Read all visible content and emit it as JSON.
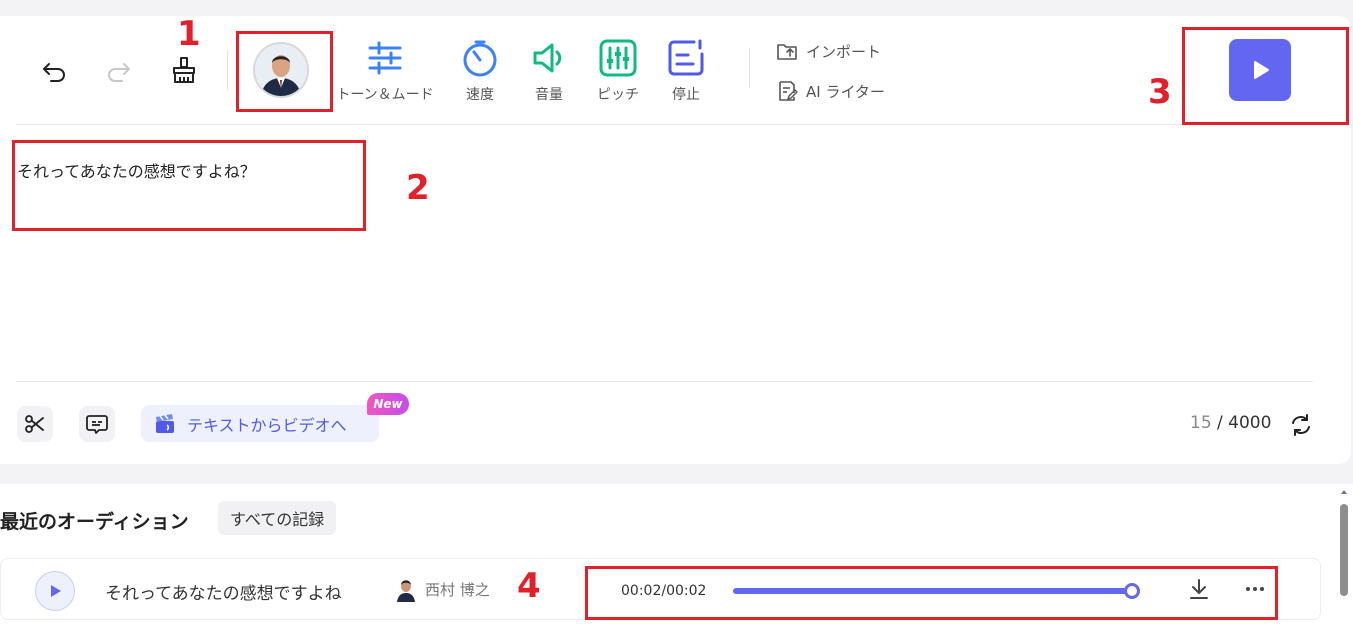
{
  "toolbar": {
    "icons": {
      "undo": "undo-icon",
      "redo": "redo-icon",
      "clear": "broom-icon"
    },
    "tools": [
      {
        "label": "トーン＆ムード",
        "icon": "sliders-icon",
        "color": "#3b82f6"
      },
      {
        "label": "速度",
        "icon": "speed-gauge-icon",
        "color": "#3b82f6"
      },
      {
        "label": "音量",
        "icon": "volume-icon",
        "color": "#10b981"
      },
      {
        "label": "ピッチ",
        "icon": "pitch-equalizer-icon",
        "color": "#10b981"
      },
      {
        "label": "停止",
        "icon": "pause-insert-icon",
        "color": "#4f5be8"
      }
    ],
    "import_label": "インポート",
    "ai_writer_label": "AI ライター"
  },
  "editor": {
    "text": "それってあなたの感想ですよね？",
    "text_to_video_label": "テキストからビデオへ",
    "new_badge": "New",
    "char_count": "15",
    "char_limit": "/ 4000"
  },
  "history": {
    "title": "最近のオーディション",
    "all_records_label": "すべての記録",
    "items": [
      {
        "text": "それってあなたの感想ですよね",
        "voice": "西村 博之",
        "time": "00:02/00:02",
        "progress": 1.0
      }
    ]
  },
  "annotations": [
    "1",
    "2",
    "3",
    "4"
  ],
  "colors": {
    "accent": "#6366f1",
    "annotation": "#e0202a"
  }
}
